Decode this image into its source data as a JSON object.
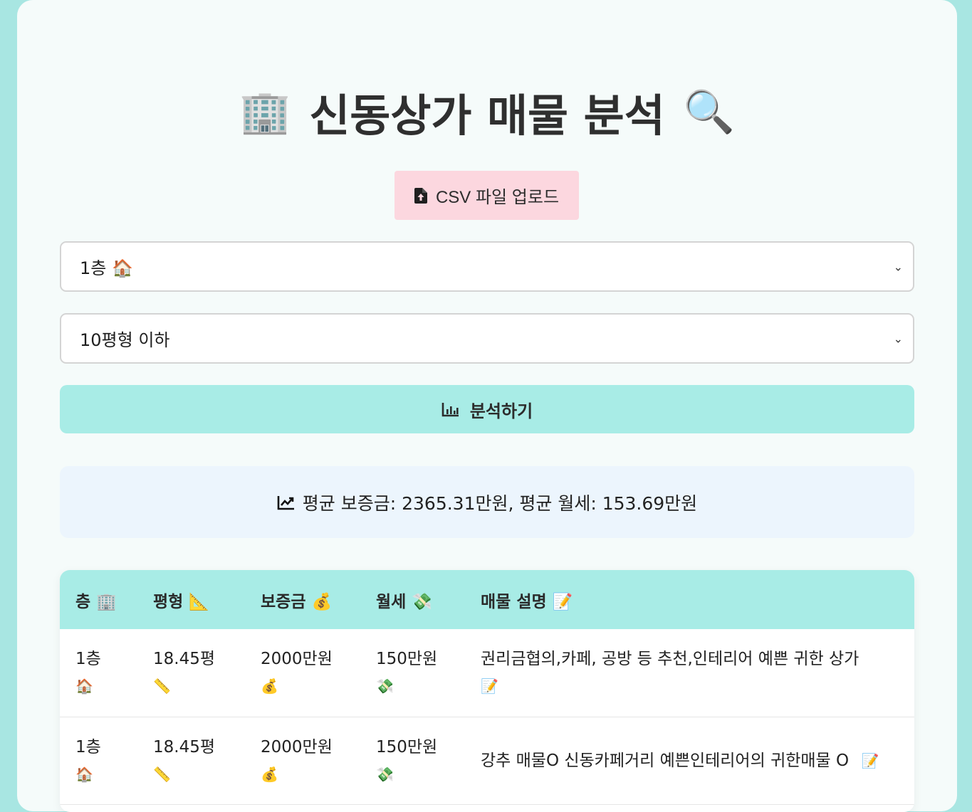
{
  "header": {
    "title": "신동상가 매물 분석",
    "title_emoji_left": "🏢",
    "title_emoji_right": "🔍"
  },
  "upload": {
    "label": "CSV 파일 업로드",
    "icon": "file-upload-icon"
  },
  "filters": {
    "floor_selected": "1층 🏠",
    "size_selected": "10평형 이하"
  },
  "analyze": {
    "label": "분석하기",
    "icon": "bar-chart-icon"
  },
  "summary": {
    "text": "평균 보증금: 2365.31만원, 평균 월세: 153.69만원",
    "icon": "line-chart-icon"
  },
  "table": {
    "headers": [
      "층 🏢",
      "평형 📐",
      "보증금 💰",
      "월세 💸",
      "매물 설명 📝"
    ],
    "rows": [
      {
        "floor": "1층",
        "floor_emoji": "🏠",
        "size": "18.45평",
        "size_emoji": "📏",
        "deposit": "2000만원",
        "deposit_emoji": "💰",
        "rent": "150만원",
        "rent_emoji": "💸",
        "desc": "권리금협의,카페, 공방 등 추천,인테리어 예쁜 귀한 상가",
        "desc_emoji": "📝"
      },
      {
        "floor": "1층",
        "floor_emoji": "🏠",
        "size": "18.45평",
        "size_emoji": "📏",
        "deposit": "2000만원",
        "deposit_emoji": "💰",
        "rent": "150만원",
        "rent_emoji": "💸",
        "desc": "강추 매물O 신동카페거리 예쁜인테리어의 귀한매물 O",
        "desc_emoji": "📝"
      }
    ]
  },
  "colors": {
    "page_bg": "#a8e6e2",
    "card_bg": "#f5fbfa",
    "upload_bg": "#fcd7df",
    "accent": "#a8ece6",
    "summary_bg": "#ecf5fd"
  }
}
